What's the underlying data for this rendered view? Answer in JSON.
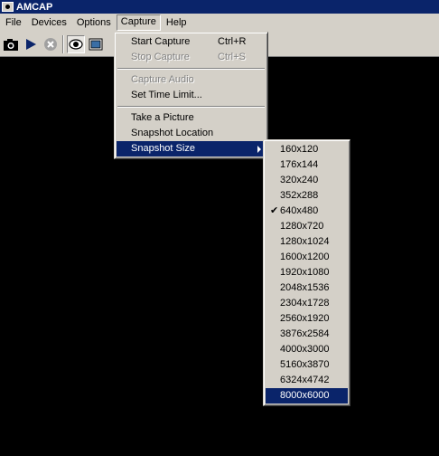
{
  "window": {
    "title": "AMCAP"
  },
  "menubar": [
    "File",
    "Devices",
    "Options",
    "Capture",
    "Help"
  ],
  "toolbar": {
    "buttons": [
      {
        "name": "camera-icon"
      },
      {
        "name": "play-icon"
      },
      {
        "name": "stop-icon"
      },
      {
        "name": "preview-eye-icon"
      },
      {
        "name": "overlay-icon"
      }
    ]
  },
  "capture_menu": {
    "items": [
      {
        "label": "Start Capture",
        "accel": "Ctrl+R",
        "enabled": true
      },
      {
        "label": "Stop Capture",
        "accel": "Ctrl+S",
        "enabled": false
      },
      {
        "separator": true
      },
      {
        "label": "Capture Audio",
        "accel": "",
        "enabled": false
      },
      {
        "label": "Set Time Limit...",
        "accel": "",
        "enabled": true
      },
      {
        "separator": true
      },
      {
        "label": "Take a Picture",
        "accel": "",
        "enabled": true
      },
      {
        "label": "Snapshot Location",
        "accel": "",
        "enabled": true
      },
      {
        "label": "Snapshot Size",
        "accel": "",
        "enabled": true,
        "submenu": true,
        "highlighted": true
      }
    ]
  },
  "snapshot_size_menu": {
    "items": [
      "160x120",
      "176x144",
      "320x240",
      "352x288",
      "640x480",
      "1280x720",
      "1280x1024",
      "1600x1200",
      "1920x1080",
      "2048x1536",
      "2304x1728",
      "2560x1920",
      "3876x2584",
      "4000x3000",
      "5160x3870",
      "6324x4742",
      "8000x6000"
    ],
    "checked": "640x480",
    "highlighted": "8000x6000"
  },
  "colors": {
    "highlight": "#0a246a",
    "face": "#d4d0c8",
    "video_bg": "#000000"
  }
}
